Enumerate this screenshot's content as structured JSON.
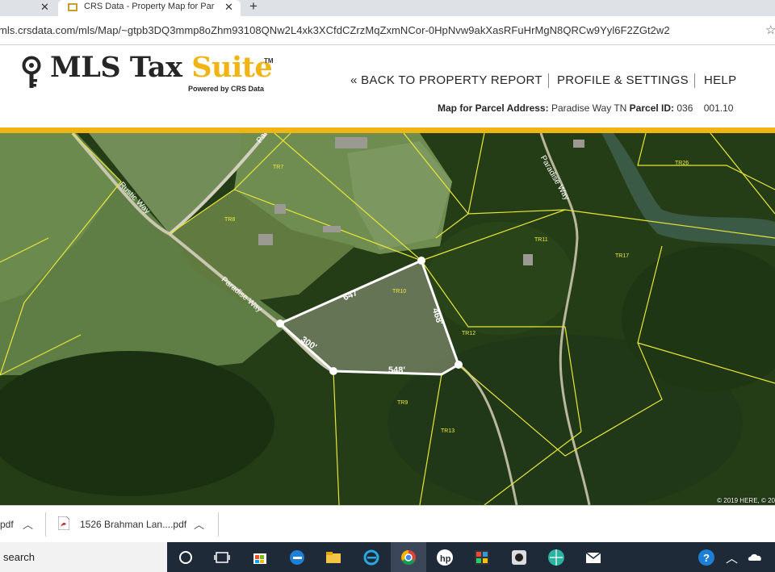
{
  "browser": {
    "tab_title": "CRS Data - Property Map for Par",
    "url": "mls.crsdata.com/mls/Map/~gtpb3DQ3mmp8oZhm93108QNw2L4xk3XCfdCZrzMqZxmNCor-0HpNvw9akXasRFuHrMgN8QRCw9Yyl6F2ZGt2w2"
  },
  "header": {
    "logo_main": "MLS Tax ",
    "logo_accent": "Suite",
    "logo_tm": "TM",
    "logo_powered": "Powered by CRS Data",
    "nav_back": "« BACK TO PROPERTY REPORT",
    "nav_profile": "PROFILE & SETTINGS",
    "nav_help": "HELP",
    "parcel_label": "Map for Parcel Address:",
    "parcel_address": "Paradise Way TN",
    "parcel_id_label": "Parcel ID:",
    "parcel_id": "036",
    "parcel_id_suffix": "001.10",
    "accent_color": "#f0b514"
  },
  "map": {
    "road_labels": [
      "Rustic Way",
      "Paradise Way",
      "Paradise Way",
      "Para"
    ],
    "tract_labels": [
      "TR7",
      "TR8",
      "TR10",
      "TR11",
      "TR12",
      "TR9",
      "TR13",
      "TR17",
      "TR26"
    ],
    "dimensions": [
      "647'",
      "468'",
      "300'",
      "548'"
    ],
    "attribution": "© 2019 HERE, © 20"
  },
  "downloads": {
    "item1": "pdf",
    "item2": "1526 Brahman Lan....pdf"
  },
  "taskbar": {
    "search": "search"
  }
}
